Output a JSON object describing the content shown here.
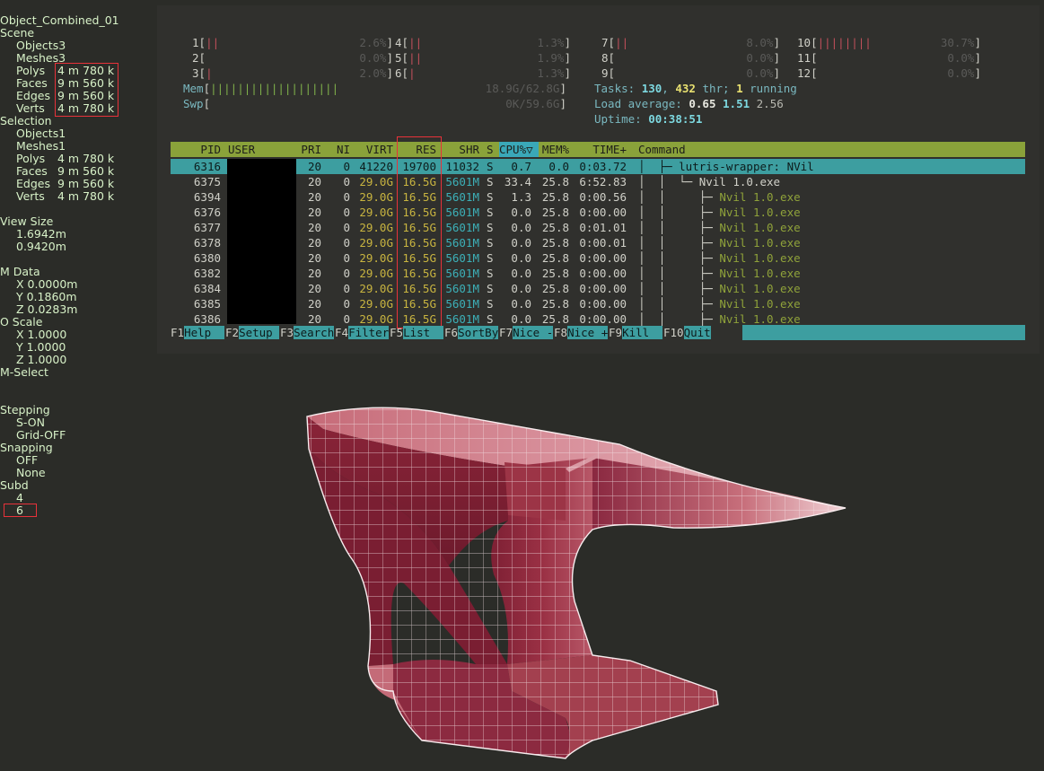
{
  "stats": {
    "object_name": "Object_Combined_01",
    "scene": {
      "label": "Scene",
      "objects": "Objects3",
      "meshes": "Meshes3",
      "polys": {
        "k": "Polys",
        "v": "4 m 780 k"
      },
      "faces": {
        "k": "Faces",
        "v": "9 m 560 k"
      },
      "edges": {
        "k": "Edges",
        "v": "9 m 560 k"
      },
      "verts": {
        "k": "Verts",
        "v": "4 m 780 k"
      }
    },
    "selection": {
      "label": "Selection",
      "objects": "Objects1",
      "meshes": "Meshes1",
      "polys": {
        "k": "Polys",
        "v": "4 m 780 k"
      },
      "faces": {
        "k": "Faces",
        "v": "9 m 560 k"
      },
      "edges": {
        "k": "Edges",
        "v": "9 m 560 k"
      },
      "verts": {
        "k": "Verts",
        "v": "4 m 780 k"
      }
    },
    "view_size": {
      "label": "View Size",
      "a": "1.6942m",
      "b": "0.9420m"
    },
    "m_data": {
      "label": "M Data",
      "x": "X 0.0000m",
      "y": "Y 0.1860m",
      "z": "Z 0.0283m"
    },
    "o_scale": {
      "label": "O Scale",
      "x": "X 1.0000",
      "y": "Y 1.0000",
      "z": "Z 1.0000"
    },
    "m_select": "M-Select",
    "stepping": {
      "label": "Stepping",
      "a": "S-ON",
      "b": "Grid-OFF"
    },
    "snapping": {
      "label": "Snapping",
      "a": "OFF",
      "b": "None"
    },
    "subd": {
      "label": "Subd",
      "a": "4",
      "b": "6"
    }
  },
  "htop": {
    "cpus": [
      {
        "n": "1",
        "bars": "||",
        "pct": "2.6%"
      },
      {
        "n": "2",
        "bars": "",
        "pct": "0.0%"
      },
      {
        "n": "3",
        "bars": "|",
        "pct": "2.0%"
      },
      {
        "n": "4",
        "bars": "||",
        "pct": "1.3%"
      },
      {
        "n": "5",
        "bars": "||",
        "pct": "1.9%"
      },
      {
        "n": "6",
        "bars": "|",
        "pct": "1.3%"
      },
      {
        "n": "7",
        "bars": "||",
        "pct": "8.0%"
      },
      {
        "n": "8",
        "bars": "",
        "pct": "0.0%"
      },
      {
        "n": "9",
        "bars": "",
        "pct": "0.0%"
      },
      {
        "n": "10",
        "bars": "||||||||",
        "pct": "30.7%"
      },
      {
        "n": "11",
        "bars": "",
        "pct": "0.0%"
      },
      {
        "n": "12",
        "bars": "",
        "pct": "0.0%"
      }
    ],
    "mem": {
      "label": "Mem",
      "bars": "|||||||||||||||||||",
      "val": "18.9G/62.8G"
    },
    "swp": {
      "label": "Swp",
      "bars": "",
      "val": "0K/59.6G"
    },
    "tasks": {
      "label": "Tasks:",
      "count": "130",
      "thr": "432",
      "thr_label": "thr;",
      "running": "1",
      "running_label": "running"
    },
    "load": {
      "label": "Load average:",
      "a": "0.65",
      "b": "1.51",
      "c": "2.56"
    },
    "uptime": {
      "label": "Uptime:",
      "v": "00:38:51"
    },
    "columns": {
      "pid": "PID",
      "user": "USER",
      "pri": "PRI",
      "ni": "NI",
      "virt": "VIRT",
      "res": "RES",
      "shr": "SHR",
      "s": "S",
      "cpu": "CPU%▽",
      "mem": "MEM%",
      "time": "TIME+",
      "cmd": "Command"
    },
    "processes": [
      {
        "pid": "6316",
        "pri": "20",
        "ni": "0",
        "virt": "41220",
        "res": "19700",
        "shr": "11032",
        "s": "S",
        "cpu": "0.7",
        "mem": "0.0",
        "time": "0:03.72",
        "tree": "│  ├─ ",
        "cmd": "lutris-wrapper: NVil",
        "kind": "main"
      },
      {
        "pid": "6375",
        "pri": "20",
        "ni": "0",
        "virt": "29.0G",
        "res": "16.5G",
        "shr": "5601M",
        "s": "S",
        "cpu": "33.4",
        "mem": "25.8",
        "time": "6:52.83",
        "tree": "│  │  └─ ",
        "cmd": "Nvil 1.0.exe",
        "kind": "main"
      },
      {
        "pid": "6394",
        "pri": "20",
        "ni": "0",
        "virt": "29.0G",
        "res": "16.5G",
        "shr": "5601M",
        "s": "S",
        "cpu": "1.3",
        "mem": "25.8",
        "time": "0:00.56",
        "tree": "│  │     ├─ ",
        "cmd": "Nvil 1.0.exe",
        "kind": "thread"
      },
      {
        "pid": "6376",
        "pri": "20",
        "ni": "0",
        "virt": "29.0G",
        "res": "16.5G",
        "shr": "5601M",
        "s": "S",
        "cpu": "0.0",
        "mem": "25.8",
        "time": "0:00.00",
        "tree": "│  │     ├─ ",
        "cmd": "Nvil 1.0.exe",
        "kind": "thread"
      },
      {
        "pid": "6377",
        "pri": "20",
        "ni": "0",
        "virt": "29.0G",
        "res": "16.5G",
        "shr": "5601M",
        "s": "S",
        "cpu": "0.0",
        "mem": "25.8",
        "time": "0:01.01",
        "tree": "│  │     ├─ ",
        "cmd": "Nvil 1.0.exe",
        "kind": "thread"
      },
      {
        "pid": "6378",
        "pri": "20",
        "ni": "0",
        "virt": "29.0G",
        "res": "16.5G",
        "shr": "5601M",
        "s": "S",
        "cpu": "0.0",
        "mem": "25.8",
        "time": "0:00.01",
        "tree": "│  │     ├─ ",
        "cmd": "Nvil 1.0.exe",
        "kind": "thread"
      },
      {
        "pid": "6380",
        "pri": "20",
        "ni": "0",
        "virt": "29.0G",
        "res": "16.5G",
        "shr": "5601M",
        "s": "S",
        "cpu": "0.0",
        "mem": "25.8",
        "time": "0:00.00",
        "tree": "│  │     ├─ ",
        "cmd": "Nvil 1.0.exe",
        "kind": "thread"
      },
      {
        "pid": "6382",
        "pri": "20",
        "ni": "0",
        "virt": "29.0G",
        "res": "16.5G",
        "shr": "5601M",
        "s": "S",
        "cpu": "0.0",
        "mem": "25.8",
        "time": "0:00.00",
        "tree": "│  │     ├─ ",
        "cmd": "Nvil 1.0.exe",
        "kind": "thread"
      },
      {
        "pid": "6384",
        "pri": "20",
        "ni": "0",
        "virt": "29.0G",
        "res": "16.5G",
        "shr": "5601M",
        "s": "S",
        "cpu": "0.0",
        "mem": "25.8",
        "time": "0:00.00",
        "tree": "│  │     ├─ ",
        "cmd": "Nvil 1.0.exe",
        "kind": "thread"
      },
      {
        "pid": "6385",
        "pri": "20",
        "ni": "0",
        "virt": "29.0G",
        "res": "16.5G",
        "shr": "5601M",
        "s": "S",
        "cpu": "0.0",
        "mem": "25.8",
        "time": "0:00.00",
        "tree": "│  │     ├─ ",
        "cmd": "Nvil 1.0.exe",
        "kind": "thread"
      },
      {
        "pid": "6386",
        "pri": "20",
        "ni": "0",
        "virt": "29.0G",
        "res": "16.5G",
        "shr": "5601M",
        "s": "S",
        "cpu": "0.0",
        "mem": "25.8",
        "time": "0:00.00",
        "tree": "│  │     ├─ ",
        "cmd": "Nvil 1.0.exe",
        "kind": "thread"
      }
    ],
    "fkeys": [
      {
        "n": "F1",
        "t": "Help  "
      },
      {
        "n": "F2",
        "t": "Setup "
      },
      {
        "n": "F3",
        "t": "Search"
      },
      {
        "n": "F4",
        "t": "Filter"
      },
      {
        "n": "F5",
        "t": "List  "
      },
      {
        "n": "F6",
        "t": "SortBy"
      },
      {
        "n": "F7",
        "t": "Nice -"
      },
      {
        "n": "F8",
        "t": "Nice +"
      },
      {
        "n": "F9",
        "t": "Kill  "
      },
      {
        "n": "F10",
        "t": "Quit"
      }
    ]
  },
  "colors": {
    "accent_teal": "#3d9ea0",
    "header_green": "#8aa23a",
    "highlight_red": "#e8323a",
    "mesh_red": "#8e2a3a"
  }
}
